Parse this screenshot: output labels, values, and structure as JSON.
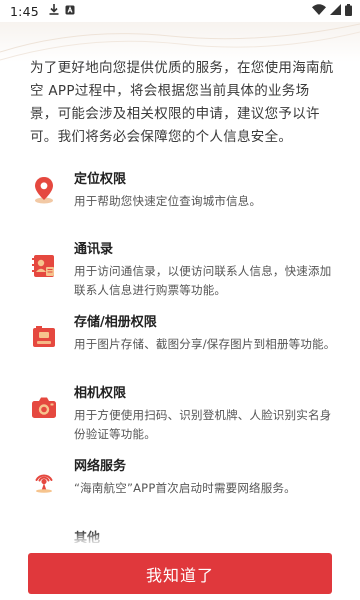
{
  "status_bar": {
    "time": "1:45"
  },
  "intro_text": "为了更好地向您提供优质的服务，在您使用海南航空 APP过程中，将会根据您当前具体的业务场景，可能会涉及相关权限的申请，建议您予以许可。我们将务必会保障您的个人信息安全。",
  "permissions": [
    {
      "icon": "location-pin-icon",
      "title": "定位权限",
      "desc": "用于帮助您快速定位查询城市信息。"
    },
    {
      "icon": "contacts-icon",
      "title": "通讯录",
      "desc": "用于访问通信录，以便访问联系人信息，快速添加联系人信息进行购票等功能。"
    },
    {
      "icon": "storage-icon",
      "title": "存储/相册权限",
      "desc": "用于图片存储、截图分享/保存图片到相册等功能。"
    },
    {
      "icon": "camera-icon",
      "title": "相机权限",
      "desc": "用于方便使用扫码、识别登机牌、人脸识别实名身份验证等功能。"
    },
    {
      "icon": "network-icon",
      "title": "网络服务",
      "desc": "“海南航空”APP首次启动时需要网络服务。"
    },
    {
      "icon": "other-icon",
      "title": "其他",
      "desc": ""
    }
  ],
  "confirm_button": {
    "label": "我知道了"
  },
  "colors": {
    "accent": "#e0383c",
    "icon_red": "#e5483f"
  }
}
